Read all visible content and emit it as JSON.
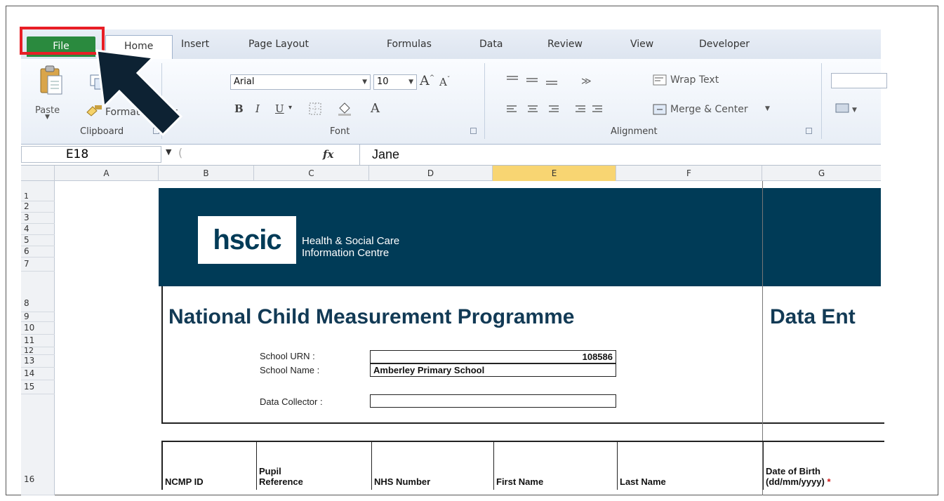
{
  "ribbon_tabs": {
    "file": "File",
    "home": "Home",
    "insert": "Insert",
    "page_layout": "Page Layout",
    "formulas": "Formulas",
    "data": "Data",
    "review": "Review",
    "view": "View",
    "developer": "Developer"
  },
  "clipboard": {
    "paste": "Paste",
    "format_painter": "Format Painter",
    "group": "Clipboard"
  },
  "font": {
    "name": "Arial",
    "size": "10",
    "bold": "B",
    "italic": "I",
    "underline": "U",
    "group": "Font"
  },
  "alignment": {
    "wrap_text": "Wrap Text",
    "merge_center": "Merge & Center",
    "group": "Alignment"
  },
  "formula_bar": {
    "cell_ref": "E18",
    "fx": "fx",
    "value": "Jane"
  },
  "columns": [
    "A",
    "B",
    "C",
    "D",
    "E",
    "F",
    "G"
  ],
  "active_column": "E",
  "rows": [
    "1",
    "2",
    "3",
    "4",
    "5",
    "6",
    "7",
    "8",
    "9",
    "10",
    "11",
    "12",
    "13",
    "14",
    "15",
    "16"
  ],
  "logo": {
    "mark": "hscic",
    "line1": "Health & Social Care",
    "line2": "Information Centre"
  },
  "sheet": {
    "title": "National Child Measurement Programme",
    "title_right": "Data Ent",
    "urn_label": "School URN :",
    "urn_value": "108586",
    "name_label": "School Name :",
    "name_value": "Amberley Primary School",
    "collector_label": "Data Collector :",
    "collector_value": ""
  },
  "table_headers": [
    "NCMP ID",
    "Pupil\nReference",
    "NHS Number",
    "First Name",
    "Last Name",
    "Date of Birth\n(dd/mm/yyyy)"
  ],
  "required_marker": "*",
  "colors": {
    "file_tab": "#2a8a3e",
    "highlight_box": "#e81e25",
    "banner": "#003b57",
    "active_col": "#f8d572",
    "arrow": "#0d2233"
  }
}
